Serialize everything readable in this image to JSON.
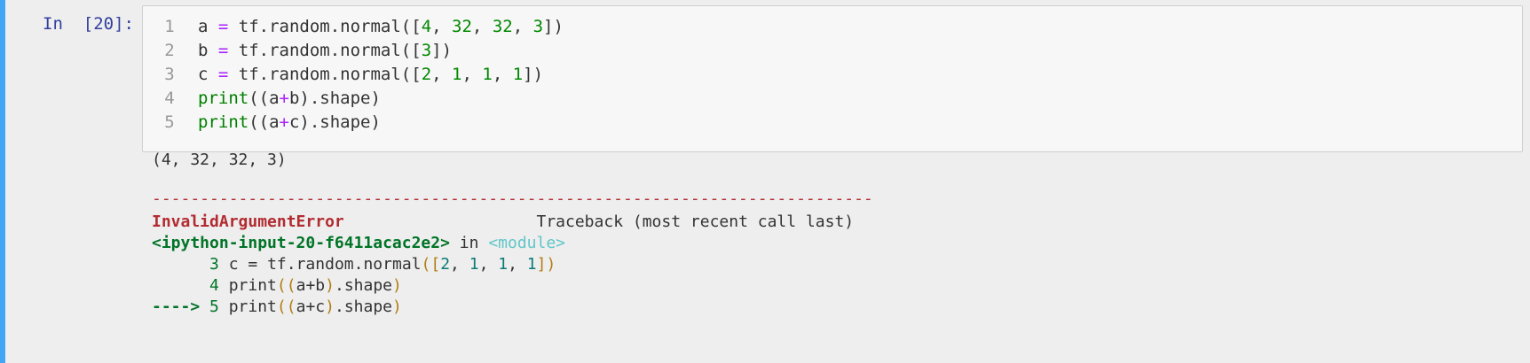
{
  "cell": {
    "prompt": "In  [20]:",
    "code_lines": [
      {
        "num": "1",
        "parts": [
          [
            "a ",
            "plain"
          ],
          [
            "=",
            "op"
          ],
          [
            " tf.random.normal([",
            "plain"
          ],
          [
            "4",
            "num"
          ],
          [
            ", ",
            "plain"
          ],
          [
            "32",
            "num"
          ],
          [
            ", ",
            "plain"
          ],
          [
            "32",
            "num"
          ],
          [
            ", ",
            "plain"
          ],
          [
            "3",
            "num"
          ],
          [
            "])",
            "plain"
          ]
        ]
      },
      {
        "num": "2",
        "parts": [
          [
            "b ",
            "plain"
          ],
          [
            "=",
            "op"
          ],
          [
            " tf.random.normal([",
            "plain"
          ],
          [
            "3",
            "num"
          ],
          [
            "])",
            "plain"
          ]
        ]
      },
      {
        "num": "3",
        "parts": [
          [
            "c ",
            "plain"
          ],
          [
            "=",
            "op"
          ],
          [
            " tf.random.normal([",
            "plain"
          ],
          [
            "2",
            "num"
          ],
          [
            ", ",
            "plain"
          ],
          [
            "1",
            "num"
          ],
          [
            ", ",
            "plain"
          ],
          [
            "1",
            "num"
          ],
          [
            ", ",
            "plain"
          ],
          [
            "1",
            "num"
          ],
          [
            "])",
            "plain"
          ]
        ]
      },
      {
        "num": "4",
        "parts": [
          [
            "print",
            "bi"
          ],
          [
            "((a",
            "plain"
          ],
          [
            "+",
            "op"
          ],
          [
            "b).shape)",
            "plain"
          ]
        ]
      },
      {
        "num": "5",
        "parts": [
          [
            "print",
            "bi"
          ],
          [
            "((a",
            "plain"
          ],
          [
            "+",
            "op"
          ],
          [
            "c).shape)",
            "plain"
          ]
        ]
      }
    ]
  },
  "output": {
    "stdout": "(4, 32, 32, 3)",
    "separator": "---------------------------------------------------------------------------",
    "error_name": "InvalidArgumentError",
    "traceback_header": "Traceback (most recent call last)",
    "input_ref": "<ipython-input-20-f6411acac2e2>",
    "in_word": " in ",
    "module_ref": "<module>",
    "tb_lines": [
      {
        "prefix": "      ",
        "num": "3",
        "parts": [
          [
            " c ",
            "plain"
          ],
          [
            "=",
            "plain"
          ],
          [
            " tf",
            "plain"
          ],
          [
            ".",
            "plain"
          ],
          [
            "random",
            "plain"
          ],
          [
            ".",
            "plain"
          ],
          [
            "normal",
            "plain"
          ],
          [
            "([",
            "paren"
          ],
          [
            "2",
            "teal"
          ],
          [
            ", ",
            "plain"
          ],
          [
            "1",
            "teal"
          ],
          [
            ", ",
            "plain"
          ],
          [
            "1",
            "teal"
          ],
          [
            ", ",
            "plain"
          ],
          [
            "1",
            "teal"
          ],
          [
            "])",
            "paren"
          ]
        ]
      },
      {
        "prefix": "      ",
        "num": "4",
        "parts": [
          [
            " print",
            "plain"
          ],
          [
            "((",
            "paren"
          ],
          [
            "a",
            "plain"
          ],
          [
            "+",
            "plain"
          ],
          [
            "b",
            "plain"
          ],
          [
            ")",
            "paren"
          ],
          [
            ".",
            "plain"
          ],
          [
            "shape",
            "plain"
          ],
          [
            ")",
            "paren"
          ]
        ]
      },
      {
        "prefix": "----> ",
        "num": "5",
        "parts": [
          [
            " print",
            "plain"
          ],
          [
            "((",
            "paren"
          ],
          [
            "a",
            "plain"
          ],
          [
            "+",
            "plain"
          ],
          [
            "c",
            "plain"
          ],
          [
            ")",
            "paren"
          ],
          [
            ".",
            "plain"
          ],
          [
            "shape",
            "plain"
          ],
          [
            ")",
            "paren"
          ]
        ]
      }
    ]
  },
  "colors": {
    "accent_bar": "#42a5f5",
    "prompt": "#303f9f",
    "error": "#b22b31",
    "green": "#007427"
  }
}
